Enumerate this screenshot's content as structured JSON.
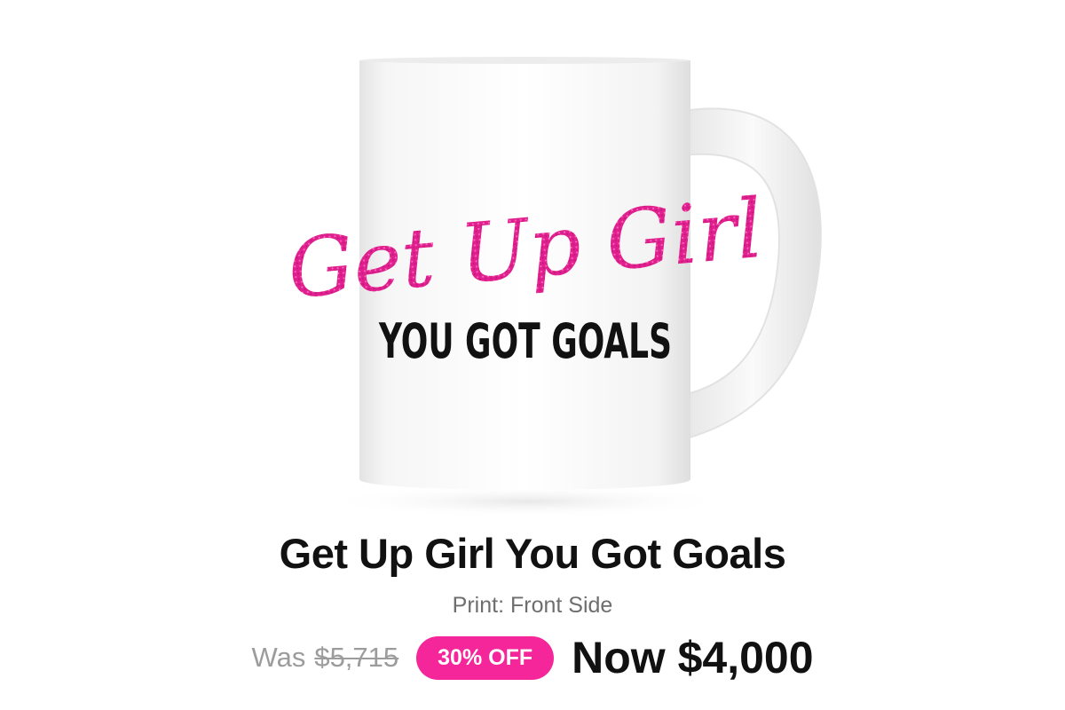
{
  "product": {
    "image_name": "white-ceramic-mug",
    "mug_text_script": "Get Up Girl",
    "mug_text_bold": "YOU GOT GOALS",
    "title": "Get Up Girl You Got Goals",
    "subtitle": "Print: Front Side"
  },
  "pricing": {
    "was_label": "Was",
    "was_price": "$5,715",
    "discount_badge": "30% OFF",
    "now_label_price": "Now $4,000"
  },
  "colors": {
    "accent_pink": "#f5259a",
    "glitter_pink": "#e01c8c",
    "text_dark": "#111111",
    "text_muted": "#9c9c9c"
  }
}
